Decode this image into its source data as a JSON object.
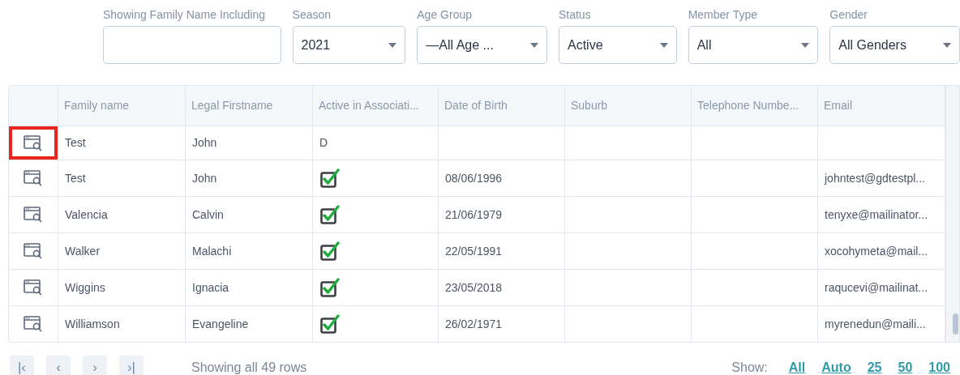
{
  "filters": [
    {
      "label": "Showing Family Name Including",
      "kind": "text"
    },
    {
      "label": "Season",
      "kind": "select",
      "value": "2021"
    },
    {
      "label": "Age Group",
      "kind": "select",
      "value": "—All Age ..."
    },
    {
      "label": "Status",
      "kind": "select",
      "value": "Active"
    },
    {
      "label": "Member Type",
      "kind": "select",
      "value": "All"
    },
    {
      "label": "Gender",
      "kind": "select",
      "value": "All Genders"
    }
  ],
  "table": {
    "columns": [
      "Family name",
      "Legal Firstname",
      "Active in Associati...",
      "Date of Birth",
      "Suburb",
      "Telephone Numbe...",
      "Email"
    ],
    "rows": [
      {
        "highlighted": true,
        "family": "Test",
        "first": "John",
        "active": {
          "kind": "text",
          "text": "D"
        }
      },
      {
        "highlighted": false,
        "family": "Test",
        "first": "John",
        "active": {
          "kind": "check",
          "checked": true
        },
        "dob": "08/06/1996",
        "email": "johntest@gdtestpl..."
      },
      {
        "highlighted": false,
        "family": "Valencia",
        "first": "Calvin",
        "active": {
          "kind": "check",
          "checked": true
        },
        "dob": "21/06/1979",
        "email": "tenyxe@mailinator..."
      },
      {
        "highlighted": false,
        "family": "Walker",
        "first": "Malachi",
        "active": {
          "kind": "check",
          "checked": true
        },
        "dob": "22/05/1991",
        "email": "xocohymeta@mail..."
      },
      {
        "highlighted": false,
        "family": "Wiggins",
        "first": "Ignacia",
        "active": {
          "kind": "check",
          "checked": true
        },
        "dob": "23/05/2018",
        "email": "raqucevi@mailinat..."
      },
      {
        "highlighted": false,
        "family": "Williamson",
        "first": "Evangeline",
        "active": {
          "kind": "check",
          "checked": true
        },
        "dob": "26/02/1971",
        "email": "myrenedun@maili..."
      }
    ]
  },
  "pager": {
    "buttons": [
      "|‹",
      "‹",
      "›",
      "›|"
    ],
    "summary": "Showing all 49 rows"
  },
  "page_size": {
    "label": "Show:",
    "options": [
      "All",
      "Auto",
      "25",
      "50",
      "100"
    ]
  }
}
